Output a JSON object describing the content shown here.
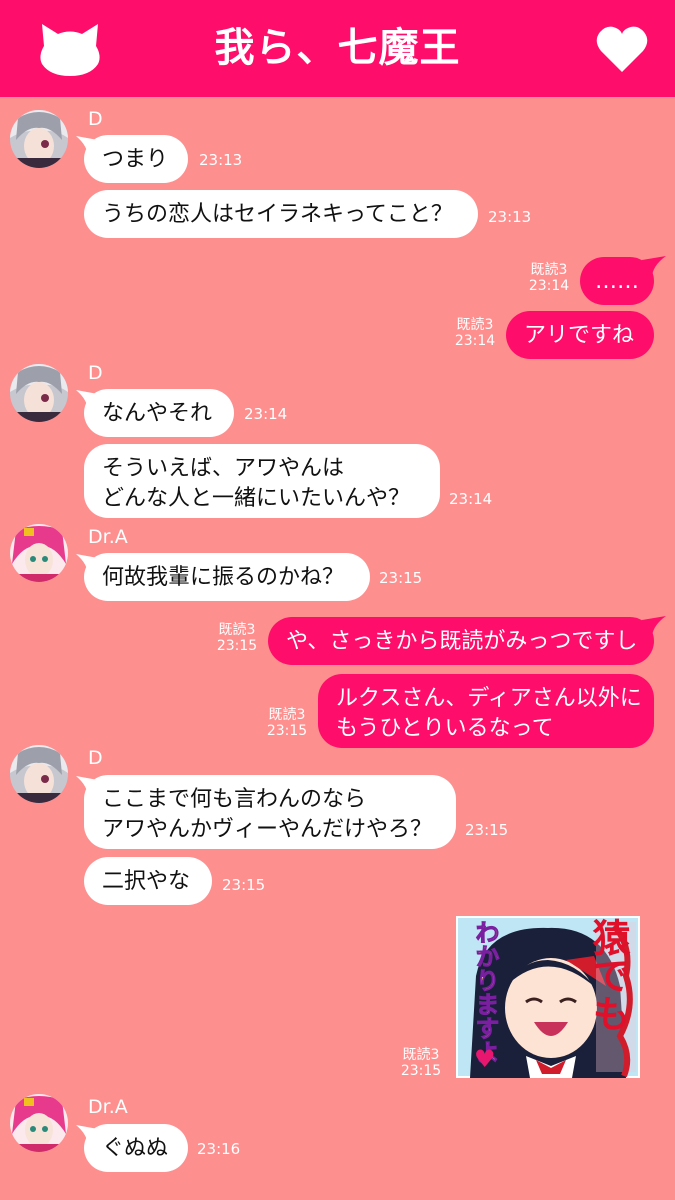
{
  "header": {
    "title": "我ら、七魔王",
    "left_icon": "cat-face-icon",
    "right_icon": "heart-icon"
  },
  "colors": {
    "background": "#fe8f8f",
    "accent": "#fe0e6a",
    "incoming": "#ffffff"
  },
  "messages": [
    {
      "sender": "D",
      "text": "つまり",
      "time": "23:13"
    },
    {
      "text": "うちの恋人はセイラネキってこと？",
      "time": "23:13"
    },
    {
      "text": "……",
      "read": "既読3",
      "time": "23:14"
    },
    {
      "text": "アリですね",
      "read": "既読3",
      "time": "23:14"
    },
    {
      "sender": "D",
      "text": "なんやそれ",
      "time": "23:14"
    },
    {
      "line1": "そういえば、アワやんは",
      "line2": "どんな人と一緒にいたいんや？",
      "time": "23:14"
    },
    {
      "sender": "Dr.A",
      "text": "何故我輩に振るのかね？",
      "time": "23:15"
    },
    {
      "text": "や、さっきから既読がみっつですし",
      "read": "既読3",
      "time": "23:15"
    },
    {
      "line1": "ルクスさん、ディアさん以外に",
      "line2": "もうひとりいるなって",
      "read": "既読3",
      "time": "23:15"
    },
    {
      "sender": "D",
      "line1": "ここまで何も言わんのなら",
      "line2": "アワやんかヴィーやんだけやろ？",
      "time": "23:15"
    },
    {
      "text": "二択やな",
      "time": "23:15"
    },
    {
      "sticker": {
        "kanji": "猿でも",
        "hira": "わかりますよ",
        "heart": "♥"
      },
      "read": "既読3",
      "time": "23:15"
    },
    {
      "sender": "Dr.A",
      "text": "ぐぬぬ",
      "time": "23:16"
    }
  ]
}
